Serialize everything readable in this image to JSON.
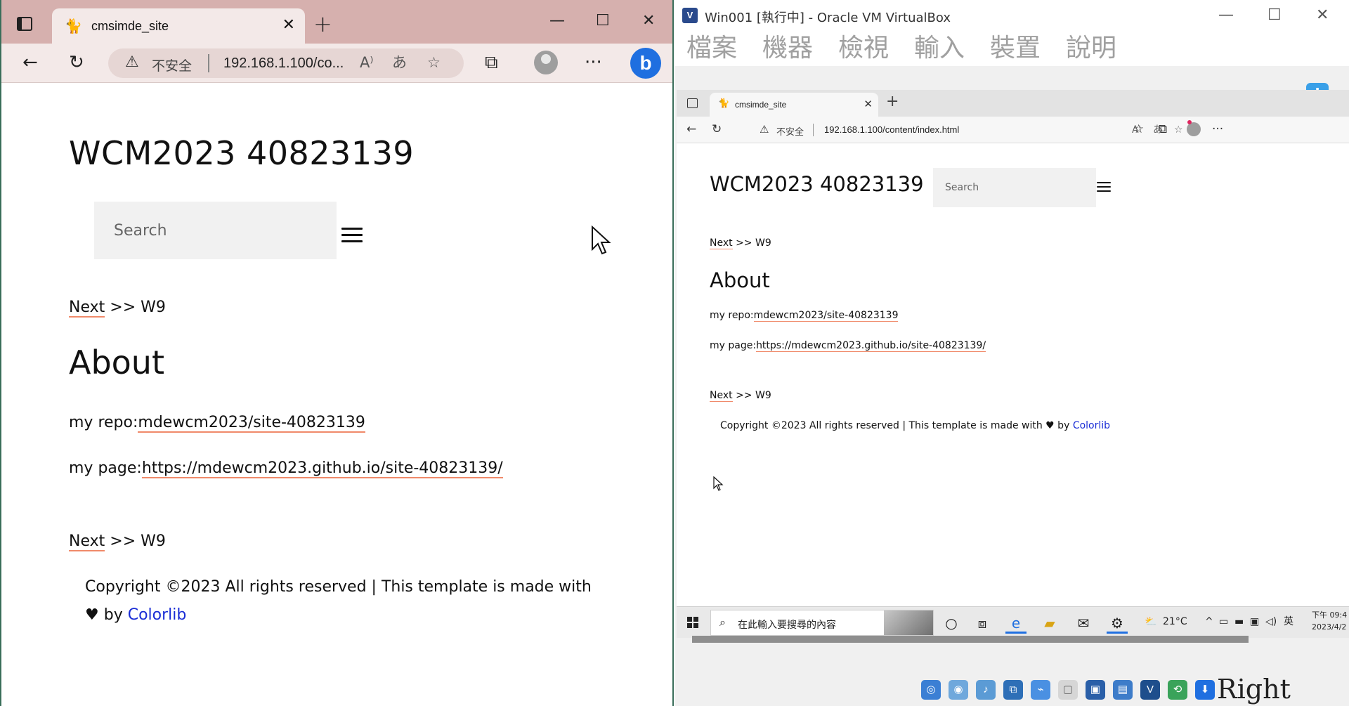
{
  "left_browser": {
    "tab_title": "cmsimde_site",
    "address": {
      "security_label": "不安全",
      "url": "192.168.1.100/co..."
    },
    "page": {
      "site_title": "WCM2023 40823139",
      "search_placeholder": "Search",
      "nav": {
        "next": "Next",
        "sep": " >> ",
        "current": "W9"
      },
      "heading": "About",
      "repo_label": "my repo:",
      "repo_link": "mdewcm2023/site-40823139",
      "page_label": "my page:",
      "page_link": "https://mdewcm2023.github.io/site-40823139/",
      "footer_text": "Copyright ©2023 All rights reserved | This template is made with",
      "footer_by": " by ",
      "footer_link": "Colorlib"
    }
  },
  "virtualbox": {
    "window_title": "Win001 [執行中] - Oracle VM VirtualBox",
    "menus": [
      "檔案",
      "機器",
      "檢視",
      "輸入",
      "裝置",
      "說明"
    ],
    "host_key": "Right Ctrl",
    "guest_browser": {
      "tab_title": "cmsimde_site",
      "security_label": "不安全",
      "url": "192.168.1.100/content/index.html"
    },
    "guest_page": {
      "site_title": "WCM2023 40823139",
      "search_placeholder": "Search",
      "nav": {
        "next": "Next",
        "sep": " >> ",
        "current": "W9"
      },
      "heading": "About",
      "repo_label": "my repo:",
      "repo_link": "mdewcm2023/site-40823139",
      "page_label": "my page:",
      "page_link": "https://mdewcm2023.github.io/site-40823139/",
      "footer_text": "Copyright ©2023 All rights reserved | This template is made with",
      "footer_by": " by ",
      "footer_link": "Colorlib"
    },
    "taskbar": {
      "search_text": "在此輸入要搜尋的內容",
      "weather": "21°C",
      "ime": "英",
      "time": "下午 09:4",
      "date": "2023/4/2"
    }
  },
  "colors": {
    "link_underline": "#f08a6a",
    "colorlib_link": "#1a2dd6",
    "edge_tabbar": "#d6b0ae",
    "window_border": "#3a6e5a"
  }
}
